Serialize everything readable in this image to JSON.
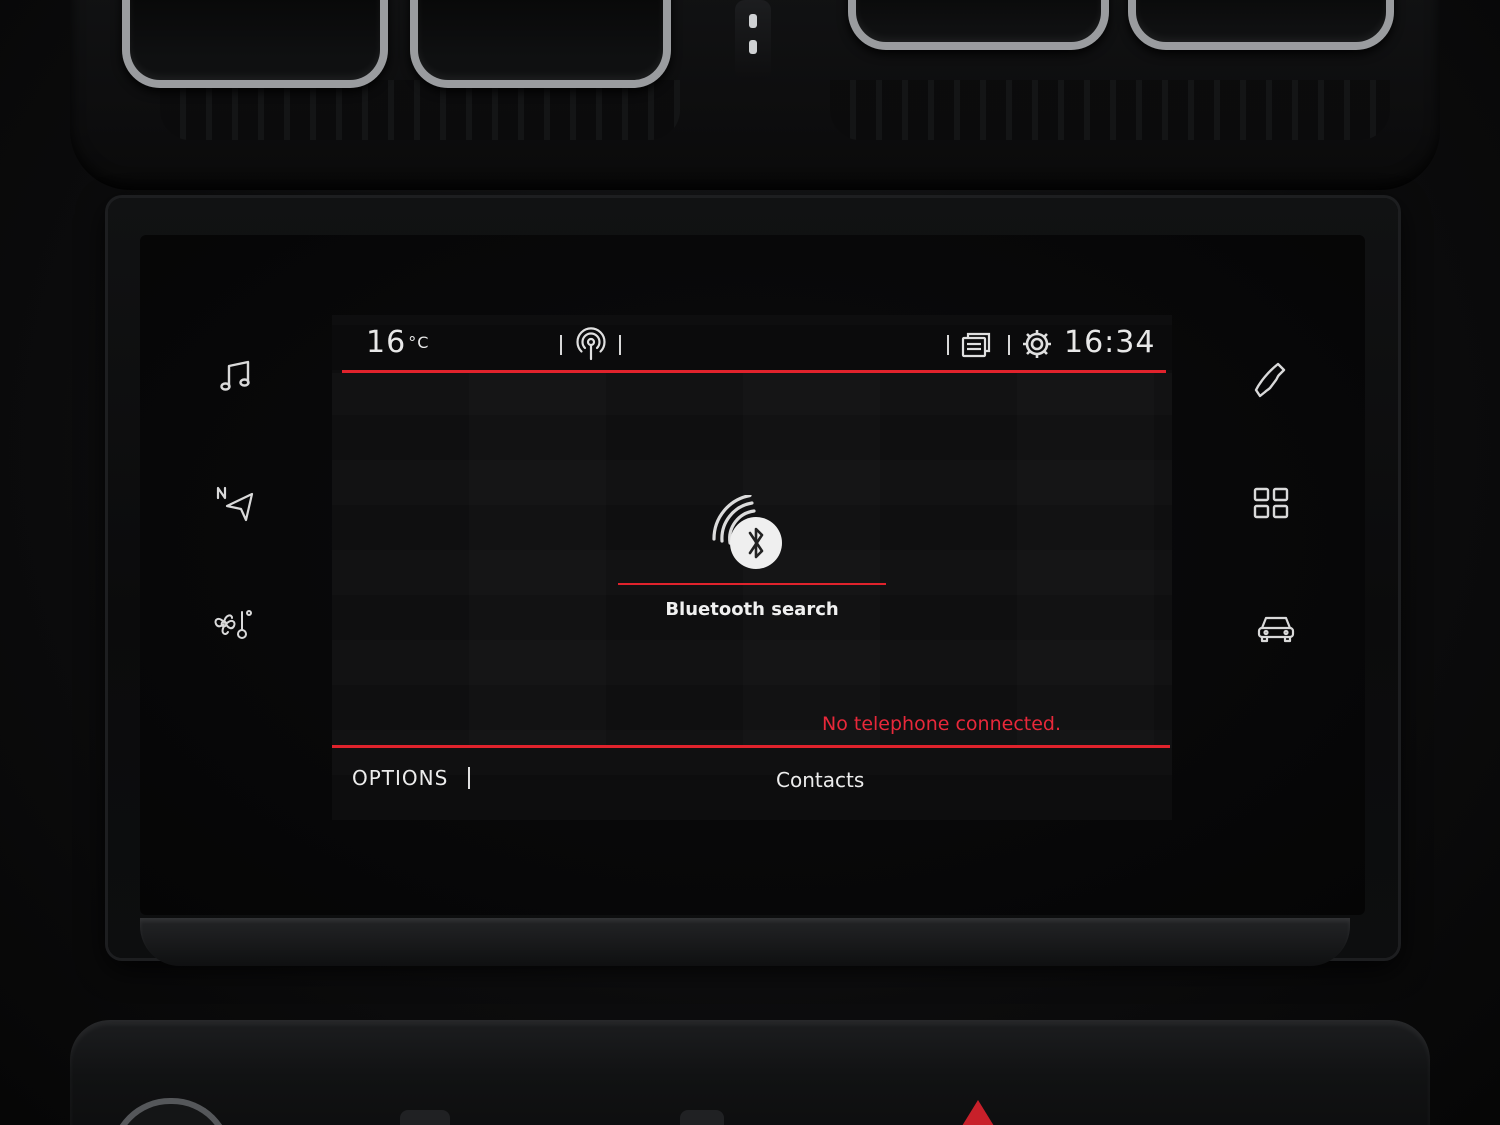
{
  "status_bar": {
    "temperature": "16",
    "temperature_unit": "°C",
    "time": "16:34",
    "icons": [
      "signal-broadcast-icon",
      "screens-icon",
      "gear-icon"
    ]
  },
  "side_menu_left": [
    {
      "id": "media",
      "icon": "music-note-icon"
    },
    {
      "id": "navigation",
      "icon": "navigation-arrow-icon",
      "label": "N"
    },
    {
      "id": "climate",
      "icon": "climate-fan-icon"
    }
  ],
  "side_menu_right": [
    {
      "id": "phone",
      "icon": "phone-handset-icon"
    },
    {
      "id": "apps",
      "icon": "apps-grid-icon"
    },
    {
      "id": "vehicle",
      "icon": "car-icon"
    }
  ],
  "main": {
    "bluetooth_label": "Bluetooth search",
    "status_message": "No telephone connected."
  },
  "bottom_bar": {
    "options_label": "OPTIONS",
    "contacts_label": "Contacts"
  },
  "colors": {
    "accent": "#e0202a",
    "text": "#ececec",
    "background": "#0f0f10"
  }
}
